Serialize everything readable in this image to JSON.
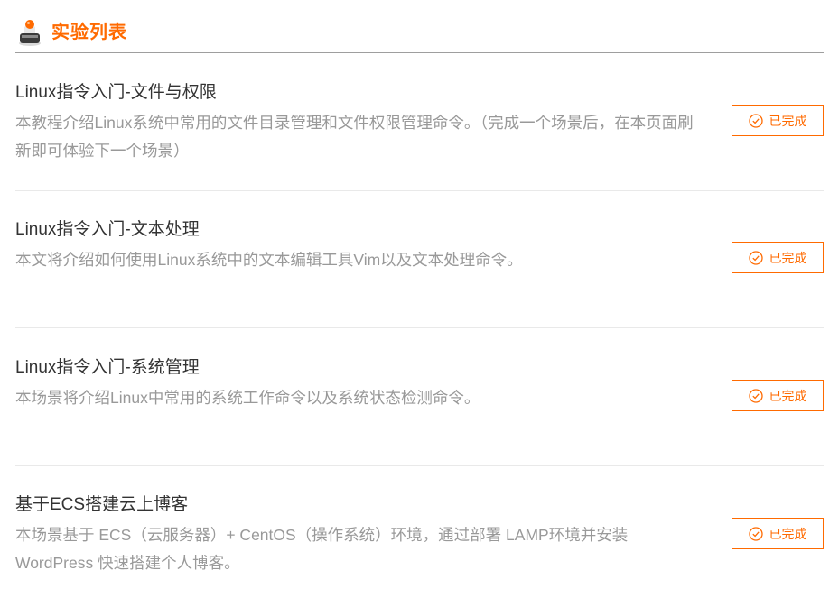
{
  "header": {
    "title": "实验列表",
    "icon": "lab-flask-icon",
    "accent_color": "#ff6a00"
  },
  "labs": [
    {
      "title": "Linux指令入门-文件与权限",
      "description": "本教程介绍Linux系统中常用的文件目录管理和文件权限管理命令。（完成一个场景后，在本页面刷新即可体验下一个场景）",
      "status_label": "已完成"
    },
    {
      "title": "Linux指令入门-文本处理",
      "description": "本文将介绍如何使用Linux系统中的文本编辑工具Vim以及文本处理命令。",
      "status_label": "已完成"
    },
    {
      "title": "Linux指令入门-系统管理",
      "description": "本场景将介绍Linux中常用的系统工作命令以及系统状态检测命令。",
      "status_label": "已完成"
    },
    {
      "title": "基于ECS搭建云上博客",
      "description": "本场景基于 ECS（云服务器）+ CentOS（操作系统）环境，通过部署 LAMP环境并安装 WordPress 快速搭建个人博客。",
      "status_label": "已完成"
    }
  ]
}
